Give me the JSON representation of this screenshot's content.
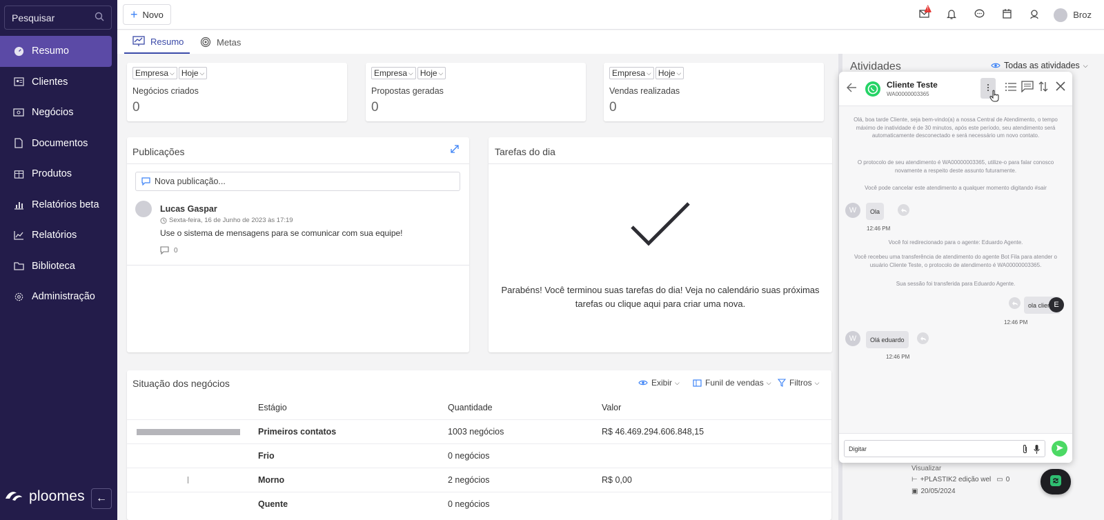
{
  "sidebar": {
    "search_placeholder": "Pesquisar",
    "items": [
      {
        "label": "Resumo",
        "icon": "gauge-icon",
        "active": true
      },
      {
        "label": "Clientes",
        "icon": "contacts-icon"
      },
      {
        "label": "Negócios",
        "icon": "money-icon"
      },
      {
        "label": "Documentos",
        "icon": "document-icon"
      },
      {
        "label": "Produtos",
        "icon": "box-icon"
      },
      {
        "label": "Relatórios beta",
        "icon": "bar-chart-icon"
      },
      {
        "label": "Relatórios",
        "icon": "line-chart-icon"
      },
      {
        "label": "Biblioteca",
        "icon": "folder-icon"
      },
      {
        "label": "Administração",
        "icon": "gear-icon"
      }
    ],
    "brand": "ploomes",
    "collapse_icon": "arrow-left-icon"
  },
  "topbar": {
    "new_label": "Novo",
    "user_name": "Broz",
    "notification_badge": "!"
  },
  "tabs": [
    {
      "label": "Resumo",
      "active": true
    },
    {
      "label": "Metas"
    }
  ],
  "metrics": [
    {
      "filter_company": "Empresa",
      "filter_period": "Hoje",
      "label": "Negócios criados",
      "value": "0"
    },
    {
      "filter_company": "Empresa",
      "filter_period": "Hoje",
      "label": "Propostas geradas",
      "value": "0"
    },
    {
      "filter_company": "Empresa",
      "filter_period": "Hoje",
      "label": "Vendas realizadas",
      "value": "0"
    }
  ],
  "publications": {
    "title": "Publicações",
    "input_placeholder": "Nova publicação...",
    "post": {
      "author": "Lucas Gaspar",
      "date": "Sexta-feira, 16 de Junho de 2023 às 17:19",
      "text": "Use o sistema de mensagens para se comunicar com sua equipe!",
      "comments": "0"
    }
  },
  "tasks": {
    "title": "Tarefas do dia",
    "message_line1": "Parabéns! Você terminou suas tarefas do dia! Veja no calendário suas próximas",
    "message_line2": "tarefas ou clique aqui para criar uma nova."
  },
  "deals": {
    "title": "Situação dos negócios",
    "controls": {
      "show": "Exibir",
      "funnel": "Funil de vendas",
      "filters": "Filtros"
    },
    "columns": [
      "Estágio",
      "Quantidade",
      "Valor"
    ],
    "rows": [
      {
        "stage": "Primeiros contatos",
        "qty": "1003 negócios",
        "value": "R$ 46.469.294.606.848,15",
        "bar": 1.0
      },
      {
        "stage": "Frio",
        "qty": "0 negócios",
        "value": "",
        "bar": 0
      },
      {
        "stage": "Morno",
        "qty": "2 negócios",
        "value": "R$ 0,00",
        "bar": 0.002
      },
      {
        "stage": "Quente",
        "qty": "0 negócios",
        "value": "",
        "bar": 0
      }
    ]
  },
  "activities": {
    "title": "Atividades",
    "filter": "Todas as atividades",
    "behind_items": {
      "view_label": "Visualizar",
      "deal_name": "+PLASTIK2 edição wel",
      "comments": "0",
      "date": "20/05/2024"
    }
  },
  "chat": {
    "contact_name": "Cliente Teste",
    "protocol": "WA00000003365",
    "system_1": "Olá, boa tarde Cliente, seja bem-vindo(a) a nossa Central de Atendimento, o tempo máximo de inatividade é de 30 minutos, após este período, seu atendimento será automaticamente desconectado e será necessário um novo contato.",
    "system_2": "O protocolo de seu atendimento é WA00000003365, utilize-o para falar conosco novamente a respeito deste assunto futuramente.",
    "system_3": "Você pode cancelar este atendimento a qualquer momento digitando #sair",
    "msg_1": "Ola",
    "time_1": "12:46 PM",
    "system_4": "Você foi redirecionado para o agente: Eduardo Agente.",
    "system_5": "Você recebeu uma transferência de atendimento do agente Bot Fila para atender o usuário Cliente Teste, o protocolo de atendimento é WA00000003365.",
    "system_6": "Sua sessão foi transferida para Eduardo Agente.",
    "msg_2": "ola cliente",
    "time_2": "12:46 PM",
    "msg_3": "Olá eduardo",
    "time_3": "12:46 PM",
    "avatar_client": "W",
    "avatar_agent": "E",
    "input_placeholder": "Digitar"
  },
  "colors": {
    "sidebar": "#231c4a",
    "active": "#5b4aa6",
    "accent": "#3b4aa8",
    "whatsapp": "#25d366",
    "send": "#4cd964"
  }
}
